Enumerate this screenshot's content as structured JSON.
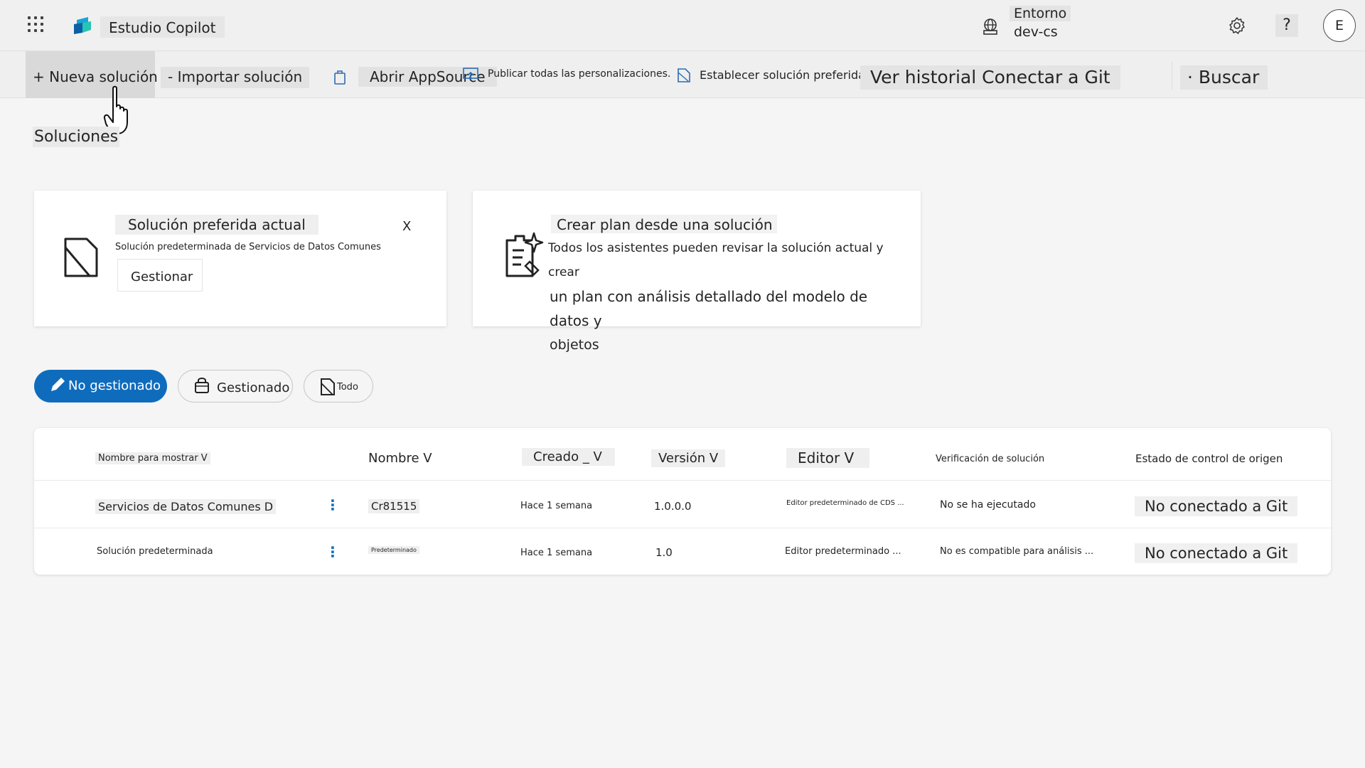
{
  "header": {
    "app_title": "Estudio Copilot",
    "env_label": "Entorno",
    "env_value": "dev-cs",
    "help": "?",
    "avatar_initial": "E"
  },
  "toolbar": {
    "new_solution": "+ Nueva solución",
    "import_solution": "- Importar solución",
    "open_appsource": "Abrir AppSource",
    "publish_all": "Publicar todas las personalizaciones.",
    "set_preferred": "Establecer solución preferida",
    "history_git": "Ver historial Conectar a Git",
    "search": "· Buscar"
  },
  "page": {
    "title": "Soluciones"
  },
  "preferred_card": {
    "title": "Solución preferida actual",
    "subtitle": "Solución predeterminada de Servicios de Datos Comunes",
    "manage_button": "Gestionar",
    "close": "X"
  },
  "plan_card": {
    "title": "Crear plan desde una solución",
    "line1": "Todos los asistentes pueden revisar la solución actual y crear",
    "line2": "un plan con análisis detallado del modelo de datos y",
    "line3": "objetos"
  },
  "filters": {
    "unmanaged": "No gestionado",
    "managed": "Gestionado",
    "all": "Todo"
  },
  "table": {
    "headers": {
      "display_name": "Nombre para mostrar V",
      "name": "Nombre V",
      "created": "Creado _ V",
      "version": "Versión V",
      "publisher": "Editor V",
      "check": "Verificación de solución",
      "source_control": "Estado de control de origen"
    },
    "rows": [
      {
        "display_name": "Servicios de Datos Comunes D",
        "more": "⋮",
        "name": "Cr81515",
        "created": "Hace 1 semana",
        "version": "1.0.0.0",
        "publisher": "Editor predeterminado de CDS ...",
        "check": "No se ha ejecutado",
        "source_control": "No conectado a Git"
      },
      {
        "display_name": "Solución predeterminada",
        "more": "⋮",
        "name": "Predeterminado",
        "created": "Hace 1 semana",
        "version": "1.0",
        "publisher": "Editor predeterminado ...",
        "check": "No es compatible para análisis ...",
        "source_control": "No conectado a Git"
      }
    ]
  },
  "colors": {
    "accent": "#0f6cbd",
    "background": "#f5f5f5"
  },
  "icons": {
    "app_launcher": "waffle-icon",
    "logo": "copilot-studio-logo",
    "environment": "globe-icon",
    "settings": "gear-icon",
    "cursor": "hand-pointer-icon"
  }
}
